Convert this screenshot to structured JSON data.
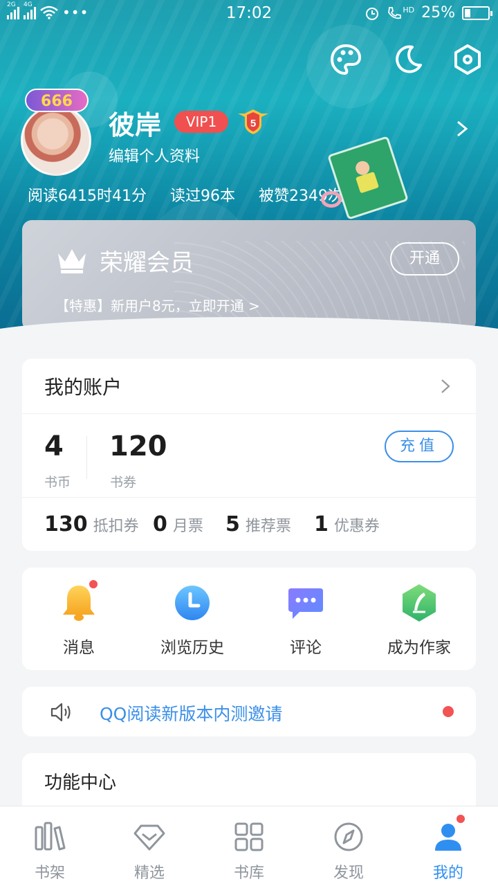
{
  "status_bar": {
    "network_1": "2G",
    "network_2": "4G",
    "time": "17:02",
    "hd_label": "HD",
    "battery": "25%"
  },
  "top_actions": [
    "palette-icon",
    "moon-icon",
    "settings-hexagon-icon"
  ],
  "profile": {
    "avatar_badge": "666",
    "name": "彼岸",
    "vip_level": "VIP1",
    "level": "5",
    "edit_label": "编辑个人资料",
    "stats": {
      "read_time": "阅读6415时41分",
      "books_read": "读过96本",
      "likes": "被赞2349次"
    }
  },
  "vip_card": {
    "title": "荣耀会员",
    "promo": "【特惠】新用户8元，立即开通 >",
    "button": "开通"
  },
  "account": {
    "title": "我的账户",
    "coins_value": "4",
    "coins_label": "书币",
    "vouchers_value": "120",
    "vouchers_label": "书券",
    "recharge": "充值",
    "tickets": [
      {
        "value": "130",
        "label": "抵扣券"
      },
      {
        "value": "0",
        "label": "月票"
      },
      {
        "value": "5",
        "label": "推荐票"
      },
      {
        "value": "1",
        "label": "优惠券"
      }
    ]
  },
  "quick_actions": [
    {
      "label": "消息",
      "icon": "bell-icon",
      "badge": true
    },
    {
      "label": "浏览历史",
      "icon": "clock-icon",
      "badge": false
    },
    {
      "label": "评论",
      "icon": "comment-icon",
      "badge": false
    },
    {
      "label": "成为作家",
      "icon": "quill-icon",
      "badge": false
    }
  ],
  "invite": {
    "text": "QQ阅读新版本内测邀请"
  },
  "function_center": {
    "title": "功能中心"
  },
  "tabs": [
    {
      "label": "书架",
      "icon": "bookshelf-icon",
      "active": false
    },
    {
      "label": "精选",
      "icon": "diamond-icon",
      "active": false
    },
    {
      "label": "书库",
      "icon": "grid-icon",
      "active": false
    },
    {
      "label": "发现",
      "icon": "compass-icon",
      "active": false
    },
    {
      "label": "我的",
      "icon": "person-icon",
      "active": true
    }
  ],
  "colors": {
    "accent": "#3b8fe8",
    "vip_red": "#f0504f",
    "badge_red": "#f25353"
  }
}
